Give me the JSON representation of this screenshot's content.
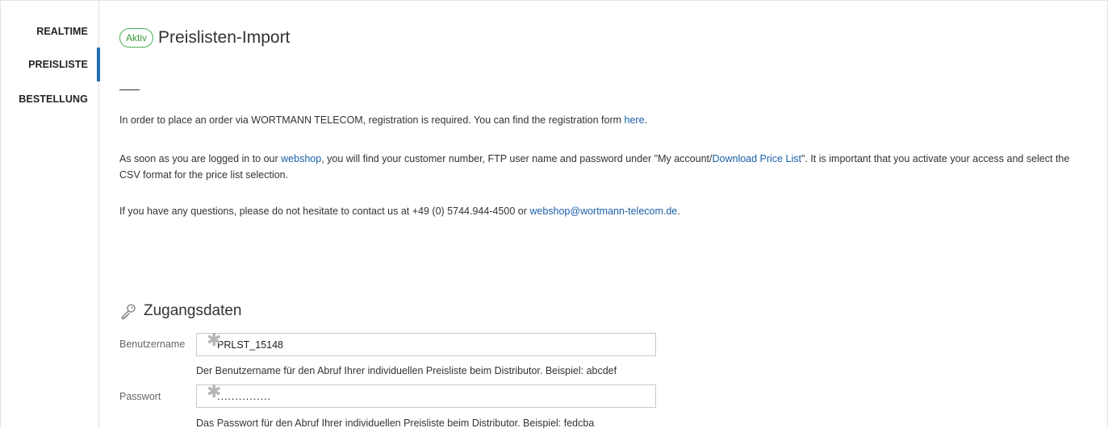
{
  "sidebar": {
    "items": [
      {
        "label": "REALTIME"
      },
      {
        "label": "PREISLISTE"
      },
      {
        "label": "BESTELLUNG"
      }
    ],
    "active_index": 1,
    "active_color": "#1f6fb5"
  },
  "header": {
    "badge": "Aktiv",
    "badge_color": "#4caf50",
    "title": "Preislisten-Import"
  },
  "intro": {
    "p1_text": "In order to place an order via WORTMANN TELECOM, registration is required. You can find the registration form ",
    "p1_link": "here",
    "p1_end": ".",
    "p2_a": "As soon as you are logged in to our ",
    "p2_link1": "webshop",
    "p2_b": ", you will find your customer number, FTP user name and password under \"My account/",
    "p2_link2": "Download Price List",
    "p2_c": "\". It is important that you activate your access and select the CSV format for the price list selection.",
    "p3_a": "If you have any questions, please do not hesitate to contact us at +49 (0) 5744.944-4500 or ",
    "p3_link": "webshop@wortmann-telecom.de",
    "p3_end": ".",
    "link_color": "#1a5fa8"
  },
  "credentials": {
    "section_title": "Zugangsdaten",
    "section_icon": "key-icon",
    "username": {
      "label": "Benutzername",
      "value": "PRLST_15148",
      "required_icon": "asterisk-icon",
      "help": "Der Benutzername für den Abruf Ihrer individuellen Preisliste beim Distributor. Beispiel: abcdef"
    },
    "password": {
      "label": "Passwort",
      "value": "...............",
      "required_icon": "asterisk-icon",
      "help": "Das Passwort für den Abruf Ihrer individuellen Preisliste beim Distributor. Beispiel: fedcba"
    }
  }
}
